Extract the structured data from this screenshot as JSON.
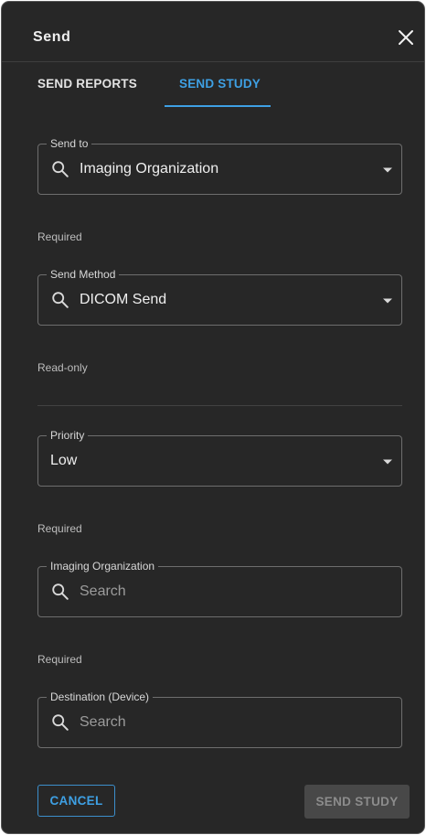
{
  "dialog": {
    "title": "Send",
    "close_icon": "close-icon"
  },
  "tabs": [
    {
      "label": "SEND REPORTS",
      "active": false
    },
    {
      "label": "SEND STUDY",
      "active": true
    }
  ],
  "fields": {
    "send_to": {
      "label": "Send to",
      "value": "Imaging Organization",
      "helper": "Required",
      "icon": "search-icon"
    },
    "send_method": {
      "label": "Send Method",
      "value": "DICOM Send",
      "helper": "Read-only",
      "icon": "search-icon"
    },
    "priority": {
      "label": "Priority",
      "value": "Low",
      "helper": "Required"
    },
    "imaging_organization": {
      "label": "Imaging Organization",
      "placeholder": "Search",
      "helper": "Required",
      "icon": "search-icon"
    },
    "destination_device": {
      "label": "Destination (Device)",
      "placeholder": "Search",
      "icon": "search-icon"
    }
  },
  "footer": {
    "cancel_label": "CANCEL",
    "send_label": "SEND STUDY"
  },
  "colors": {
    "background": "#272727",
    "accent": "#3ea0e4",
    "border": "#6e6e6e",
    "disabled_button": "#484848"
  }
}
